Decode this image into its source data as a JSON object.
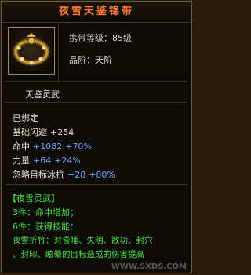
{
  "item": {
    "name": "夜雪天鉴锦带",
    "level_text": "携带等级：85级",
    "grade_text": "品阶：天阶"
  },
  "series_name": "天鉴灵武",
  "bound_text": "已绑定",
  "stats": [
    {
      "label": "基础闪避",
      "base": "+254",
      "bonus": ""
    },
    {
      "label": "命中",
      "base": "+1082",
      "bonus": "+70%"
    },
    {
      "label": "力量",
      "base": "+64",
      "bonus": "+24%"
    },
    {
      "label": "忽略目标冰抗",
      "base": "+28",
      "bonus": "+80%"
    }
  ],
  "set": {
    "title": "【夜雪灵武】",
    "line1": "3件：命中增加；",
    "line2": "6件：获得技能：",
    "line3": "夜雪折竹：对昏睡、失明、散功、封穴",
    "line4": "、封印、眩晕的目标造成的伤害提高"
  },
  "watermark": "WWW.SXDS.COM",
  "colors": {
    "title": "#ff7a3a",
    "stat_base": "#6aa8ff",
    "set_text": "#48e048"
  }
}
